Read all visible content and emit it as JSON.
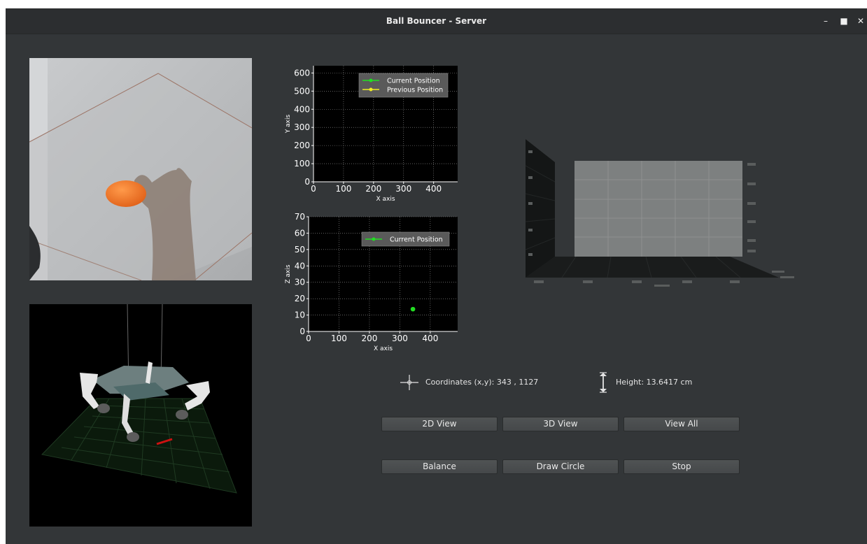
{
  "window": {
    "title": "Ball Bouncer - Server",
    "controls": [
      "minimize",
      "maximize",
      "close"
    ]
  },
  "xy_plot": {
    "xlabel": "X axis",
    "ylabel": "Y axis",
    "xticks": [
      "0",
      "100",
      "200",
      "300",
      "400"
    ],
    "yticks": [
      "0",
      "100",
      "200",
      "300",
      "400",
      "500",
      "600"
    ],
    "legend": [
      "Current Position",
      "Previous Position"
    ]
  },
  "xz_plot": {
    "xlabel": "X axis",
    "ylabel": "Z axis",
    "xticks": [
      "0",
      "100",
      "200",
      "300",
      "400"
    ],
    "yticks": [
      "0",
      "10",
      "20",
      "30",
      "40",
      "50",
      "60",
      "70"
    ],
    "legend": [
      "Current Position"
    ]
  },
  "chart_data": [
    {
      "type": "scatter",
      "xlabel": "X axis",
      "ylabel": "Y axis",
      "xlim": [
        0,
        480
      ],
      "ylim": [
        0,
        640
      ],
      "grid": true,
      "legend_position": "top-right",
      "series": [
        {
          "name": "Current Position",
          "color": "#22dd22",
          "points": []
        },
        {
          "name": "Previous Position",
          "color": "#eeee22",
          "points": []
        }
      ]
    },
    {
      "type": "scatter",
      "xlabel": "X axis",
      "ylabel": "Z axis",
      "xlim": [
        0,
        490
      ],
      "ylim": [
        0,
        70
      ],
      "grid": true,
      "legend_position": "top-right",
      "series": [
        {
          "name": "Current Position",
          "color": "#22dd22",
          "points": [
            [
              343,
              13.6
            ]
          ]
        }
      ]
    }
  ],
  "info": {
    "coordinates": "Coordinates (x,y): 343  , 1127",
    "height": "Height: 13.6417 cm",
    "crosshair_icon": "crosshair-icon",
    "height_icon": "height-icon"
  },
  "buttons": {
    "view_2d": "2D View",
    "view_3d": "3D View",
    "view_all": "View All",
    "balance": "Balance",
    "draw_circle": "Draw Circle",
    "stop": "Stop"
  },
  "colors": {
    "window_bg": "#333638",
    "titlebar_bg": "#2c2e30",
    "current_position": "#22dd22",
    "previous_position": "#eeee22",
    "ball": "#f07a2a"
  }
}
